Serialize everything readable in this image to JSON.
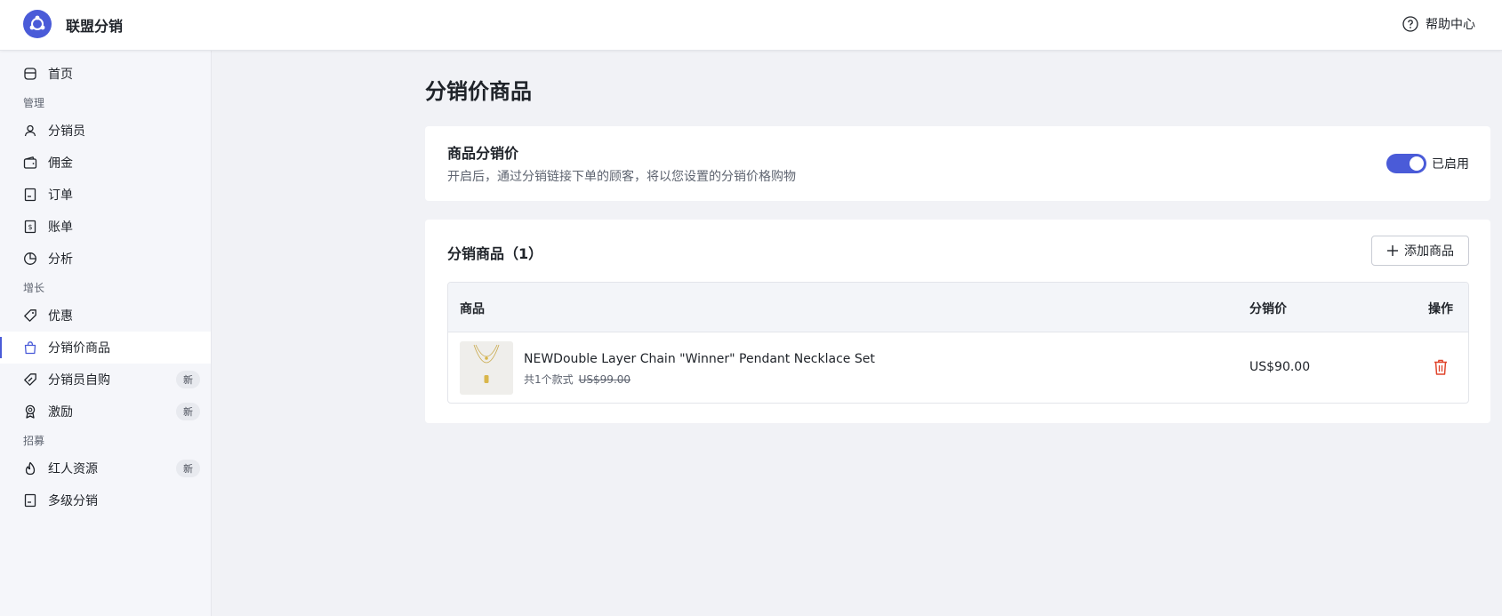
{
  "app": {
    "title": "联盟分销",
    "help_label": "帮助中心"
  },
  "sidebar": {
    "home": "首页",
    "section_manage": "管理",
    "distributors": "分销员",
    "commission": "佣金",
    "orders": "订单",
    "bills": "账单",
    "analytics": "分析",
    "section_growth": "增长",
    "offers": "优惠",
    "distribution_price_products": "分销价商品",
    "self_purchase": "分销员自购",
    "self_purchase_badge": "新",
    "incentives": "激励",
    "incentives_badge": "新",
    "section_recruit": "招募",
    "influencers": "红人资源",
    "influencers_badge": "新",
    "multilevel": "多级分销"
  },
  "page": {
    "title": "分销价商品"
  },
  "price_card": {
    "title": "商品分销价",
    "description": "开启后，通过分销链接下单的顾客，将以您设置的分销价格购物",
    "toggle_label": "已启用",
    "enabled": true
  },
  "products_card": {
    "title": "分销商品（1）",
    "add_button": "添加商品",
    "columns": {
      "product": "商品",
      "price": "分销价",
      "actions": "操作"
    },
    "rows": [
      {
        "name": "NEWDouble Layer Chain \"Winner\" Pendant Necklace Set",
        "variants": "共1个款式",
        "original_price": "US$99.00",
        "distribution_price": "US$90.00"
      }
    ]
  },
  "colors": {
    "accent": "#4a5bd8",
    "danger": "#e0442b",
    "background": "#f1f2f6"
  }
}
